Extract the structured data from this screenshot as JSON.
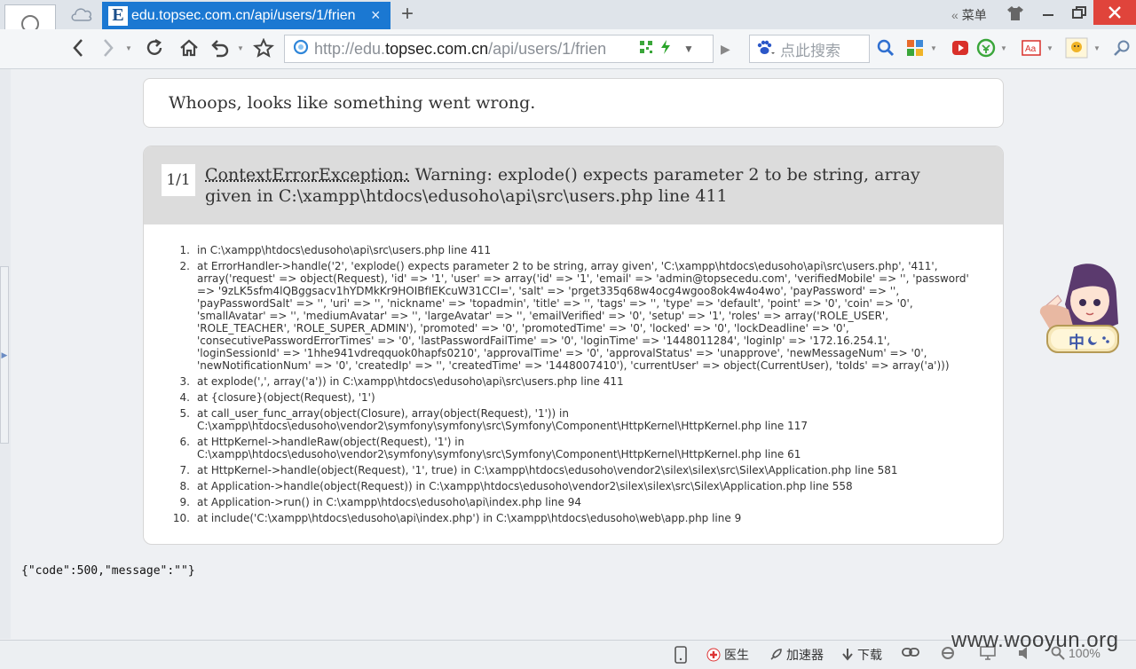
{
  "browser": {
    "tab": {
      "title": "edu.topsec.com.cn/api/users/1/frien",
      "favicon_letter": "E",
      "close": "×"
    },
    "new_tab": "+",
    "menu_label": "菜单",
    "menu_chevron": "«",
    "address": {
      "scheme": "http://edu.",
      "host": "topsec.com.cn",
      "path": "/api/users/1/frien"
    },
    "search": {
      "placeholder": "点此搜索"
    }
  },
  "page": {
    "whoops": "Whoops, looks like something went wrong.",
    "exception": {
      "counter": "1/1",
      "class_name": "ContextErrorException:",
      "message": " Warning: explode() expects parameter 2 to be string, array given in C:\\xampp\\htdocs\\edusoho\\api\\src\\users.php line 411"
    },
    "trace": [
      {
        "num": "1.",
        "text": "in C:\\xampp\\htdocs\\edusoho\\api\\src\\users.php line 411"
      },
      {
        "num": "2.",
        "lines": [
          "at ErrorHandler->handle('2', 'explode() expects parameter 2 to be string, array given', 'C:\\xampp\\htdocs\\edusoho\\api\\src\\users.php', '411',",
          "array('request' => object(Request), 'id' => '1', 'user' => array('id' => '1', 'email' => 'admin@topsecedu.com', 'verifiedMobile' => '', 'password'",
          "=> '9zLK5sfm4lQBggsacv1hYDMkKr9HOIBfIEKcuW31CCI=', 'salt' => 'prget335q68w4ocg4wgoo8ok4w4o4wo', 'payPassword' => '',",
          "'payPasswordSalt' => '', 'uri' => '', 'nickname' => 'topadmin', 'title' => '', 'tags' => '', 'type' => 'default', 'point' => '0', 'coin' => '0',",
          "'smallAvatar' => '', 'mediumAvatar' => '', 'largeAvatar' => '', 'emailVerified' => '0', 'setup' => '1', 'roles' => array('ROLE_USER',",
          "'ROLE_TEACHER', 'ROLE_SUPER_ADMIN'), 'promoted' => '0', 'promotedTime' => '0', 'locked' => '0', 'lockDeadline' => '0',",
          "'consecutivePasswordErrorTimes' => '0', 'lastPasswordFailTime' => '0', 'loginTime' => '1448011284', 'loginIp' => '172.16.254.1',",
          "'loginSessionId' => '1hhe941vdreqquok0hapfs0210', 'approvalTime' => '0', 'approvalStatus' => 'unapprove', 'newMessageNum' => '0',",
          "'newNotificationNum' => '0', 'createdIp' => '', 'createdTime' => '1448007410'), 'currentUser' => object(CurrentUser), 'toIds' => array('a')))"
        ]
      },
      {
        "num": "3.",
        "text": "at explode(',', array('a')) in C:\\xampp\\htdocs\\edusoho\\api\\src\\users.php line 411"
      },
      {
        "num": "4.",
        "text": "at {closure}(object(Request), '1')"
      },
      {
        "num": "5.",
        "lines": [
          "at call_user_func_array(object(Closure), array(object(Request), '1')) in",
          "C:\\xampp\\htdocs\\edusoho\\vendor2\\symfony\\symfony\\src\\Symfony\\Component\\HttpKernel\\HttpKernel.php line 117"
        ]
      },
      {
        "num": "6.",
        "lines": [
          "at HttpKernel->handleRaw(object(Request), '1') in",
          "C:\\xampp\\htdocs\\edusoho\\vendor2\\symfony\\symfony\\src\\Symfony\\Component\\HttpKernel\\HttpKernel.php line 61"
        ]
      },
      {
        "num": "7.",
        "text": "at HttpKernel->handle(object(Request), '1', true) in C:\\xampp\\htdocs\\edusoho\\vendor2\\silex\\silex\\src\\Silex\\Application.php line 581"
      },
      {
        "num": "8.",
        "text": "at Application->handle(object(Request)) in C:\\xampp\\htdocs\\edusoho\\vendor2\\silex\\silex\\src\\Silex\\Application.php line 558"
      },
      {
        "num": "9.",
        "text": "at Application->run() in C:\\xampp\\htdocs\\edusoho\\api\\index.php line 94"
      },
      {
        "num": "10.",
        "text": "at include('C:\\xampp\\htdocs\\edusoho\\api\\index.php') in C:\\xampp\\htdocs\\edusoho\\web\\app.php line 9"
      }
    ],
    "json_output": "{\"code\":500,\"message\":\"\"}"
  },
  "mascot_label": "中",
  "statusbar": {
    "doctor": "医生",
    "accelerator": "加速器",
    "download": "下载",
    "zoom": "100%"
  },
  "watermark": "www.wooyun.org",
  "colors": {
    "tab_active": "#1b78d2",
    "close_button": "#e0443b"
  }
}
